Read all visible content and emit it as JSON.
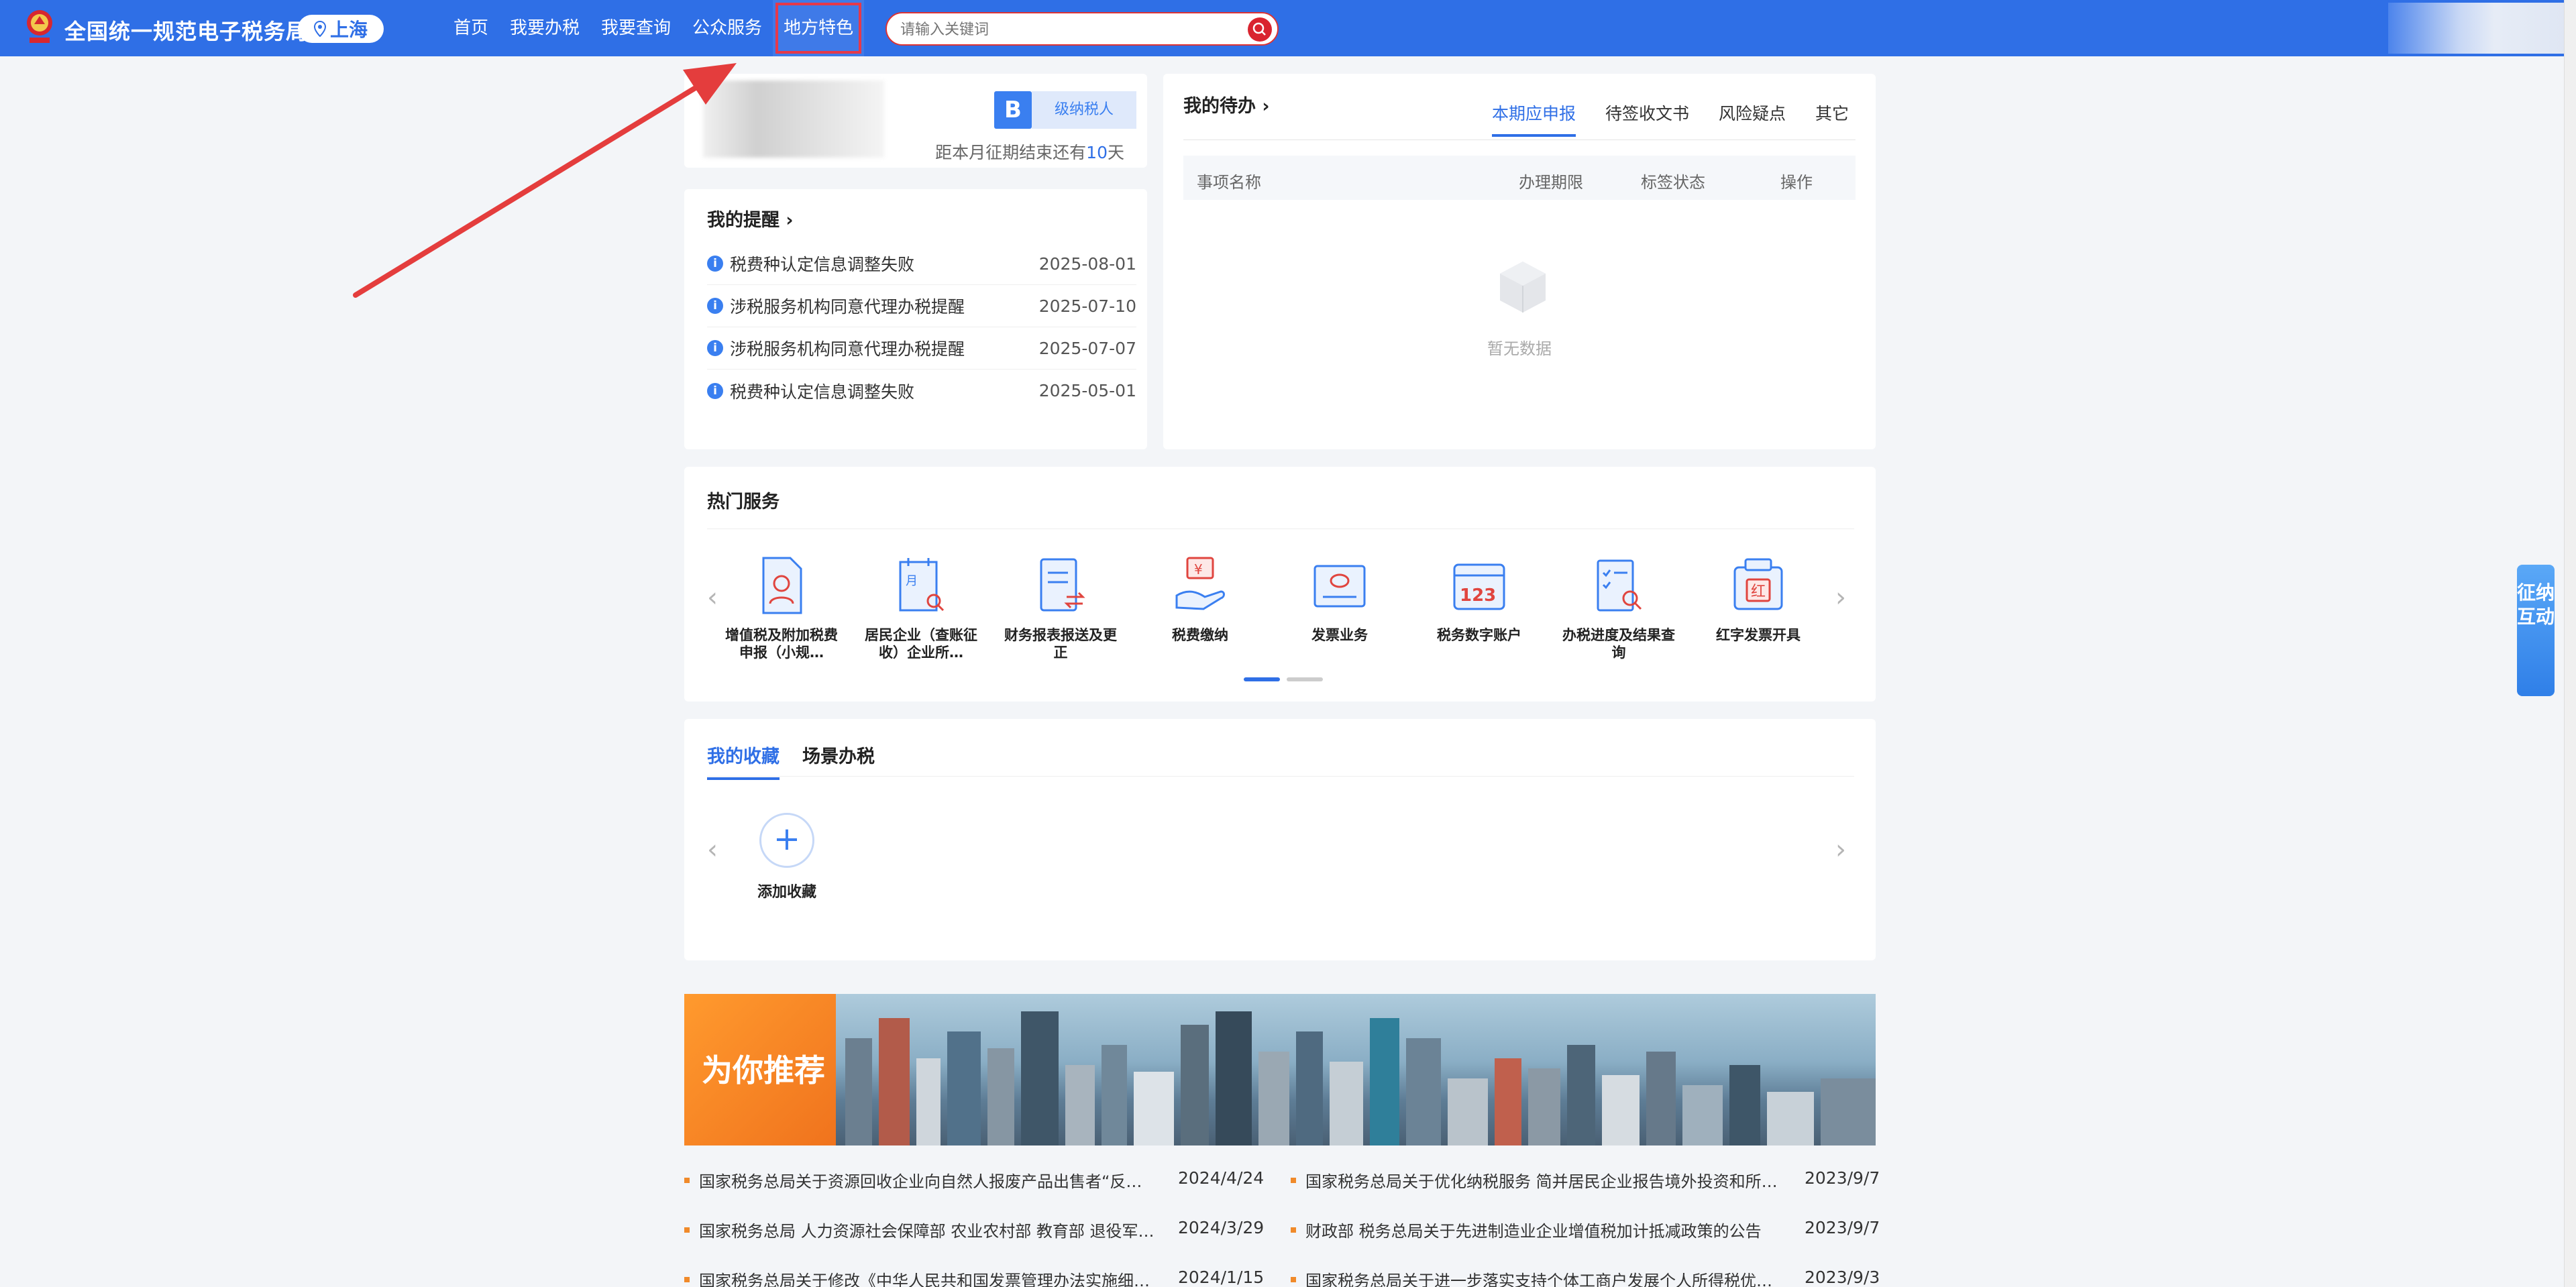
{
  "header": {
    "app_title": "全国统一规范电子税务局",
    "city": "上海",
    "nav": [
      "首页",
      "我要办税",
      "我要查询",
      "公众服务",
      "地方特色"
    ],
    "search_placeholder": "请输入关键词",
    "accent": "#2f6fe6",
    "highlight_color": "#e5394a"
  },
  "profile": {
    "badge_letter": "B",
    "badge_text": "级纳税人",
    "deadline_prefix": "距本月征期结束还有",
    "deadline_days": "10",
    "deadline_suffix": "天"
  },
  "reminders": {
    "title": "我的提醒 ›",
    "items": [
      {
        "text": "税费种认定信息调整失败",
        "date": "2025-08-01"
      },
      {
        "text": "涉税服务机构同意代理办税提醒",
        "date": "2025-07-10"
      },
      {
        "text": "涉税服务机构同意代理办税提醒",
        "date": "2025-07-07"
      },
      {
        "text": "税费种认定信息调整失败",
        "date": "2025-05-01"
      }
    ]
  },
  "todo": {
    "title": "我的待办 ›",
    "tabs": [
      "本期应申报",
      "待签收文书",
      "风险疑点",
      "其它"
    ],
    "columns": [
      "事项名称",
      "办理期限",
      "标签状态",
      "操作"
    ],
    "empty_text": "暂无数据"
  },
  "hot_services": {
    "title": "热门服务",
    "items": [
      {
        "label": "增值税及附加税费申报（小规…",
        "icon": "person-doc-icon"
      },
      {
        "label": "居民企业（查账征收）企业所…",
        "icon": "calendar-search-icon"
      },
      {
        "label": "财务报表报送及更正",
        "icon": "report-exchange-icon"
      },
      {
        "label": "税费缴纳",
        "icon": "hand-yuan-icon"
      },
      {
        "label": "发票业务",
        "icon": "invoice-icon"
      },
      {
        "label": "税务数字账户",
        "icon": "digital-account-icon"
      },
      {
        "label": "办税进度及结果查询",
        "icon": "checklist-search-icon"
      },
      {
        "label": "红字发票开具",
        "icon": "red-invoice-icon"
      }
    ]
  },
  "favorites": {
    "tabs": [
      "我的收藏",
      "场景办税"
    ],
    "add_label": "添加收藏"
  },
  "recommend": {
    "tag": "为你推荐"
  },
  "news": [
    {
      "title": "国家税务总局关于资源回收企业向自然人报废产品出售者“反…",
      "date": "2024/4/24"
    },
    {
      "title": "国家税务总局关于优化纳税服务 简并居民企业报告境外投资和所…",
      "date": "2023/9/7"
    },
    {
      "title": "国家税务总局 人力资源社会保障部 农业农村部 教育部 退役军…",
      "date": "2024/3/29"
    },
    {
      "title": "财政部  税务总局关于先进制造业企业增值税加计抵减政策的公告",
      "date": "2023/9/7"
    },
    {
      "title": "国家税务总局关于修改《中华人民共和国发票管理办法实施细…",
      "date": "2024/1/15"
    },
    {
      "title": "国家税务总局关于进一步落实支持个体工商户发展个人所得税优…",
      "date": "2023/9/3"
    }
  ],
  "side_float": {
    "text": "征纳互动"
  }
}
